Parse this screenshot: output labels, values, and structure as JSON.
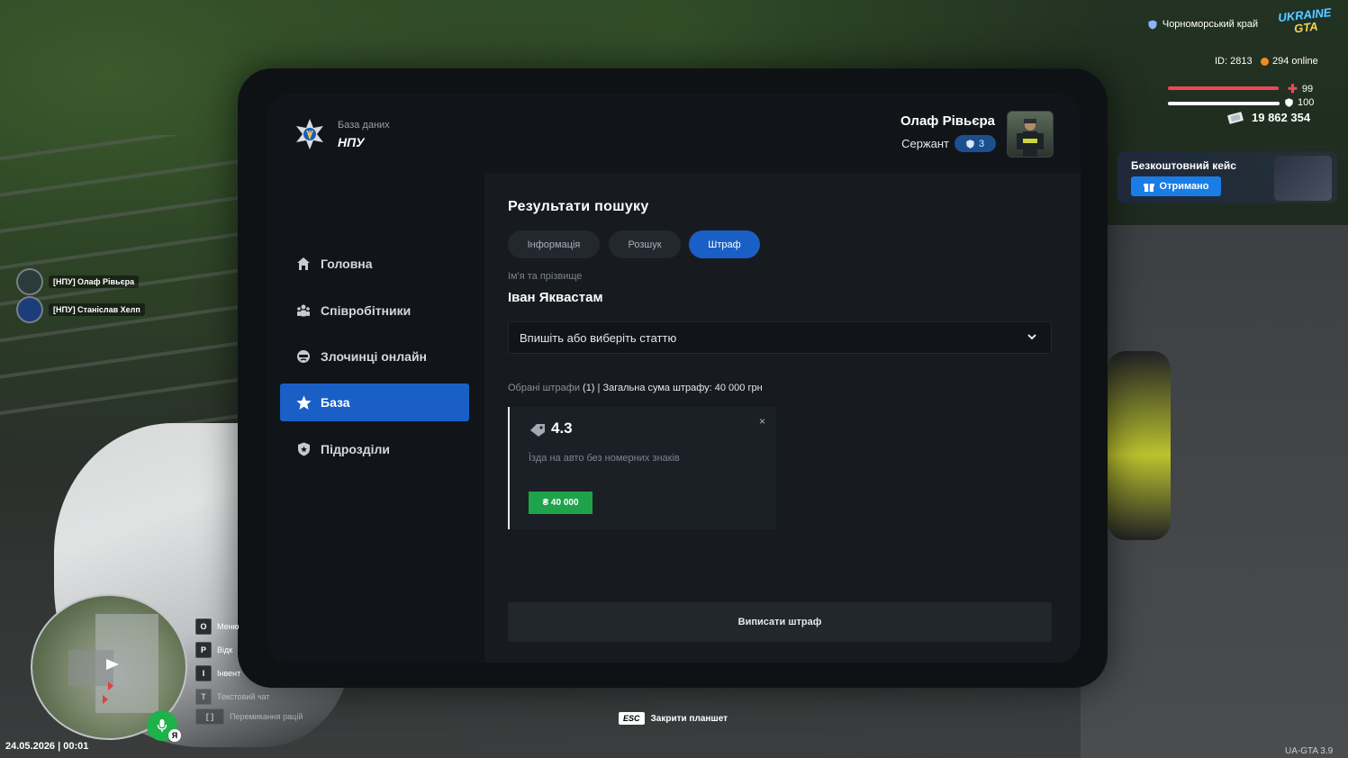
{
  "app": {
    "db_subtitle": "База даних",
    "db_title": "НПУ"
  },
  "sidebar": {
    "items": [
      {
        "label": "Головна",
        "icon": "home-icon",
        "active": false
      },
      {
        "label": "Співробітники",
        "icon": "people-icon",
        "active": false
      },
      {
        "label": "Злочинці онлайн",
        "icon": "criminal-icon",
        "active": false
      },
      {
        "label": "База",
        "icon": "star-icon",
        "active": true
      },
      {
        "label": "Підрозділи",
        "icon": "shield-icon",
        "active": false
      }
    ]
  },
  "user": {
    "name": "Олаф Рівьєра",
    "rank": "Сержант",
    "rank_level": "3"
  },
  "main": {
    "title": "Результати пошуку",
    "tabs": [
      {
        "label": "Інформація",
        "active": false
      },
      {
        "label": "Розшук",
        "active": false
      },
      {
        "label": "Штраф",
        "active": true
      }
    ],
    "name_label": "Ім'я та прізвище",
    "name_value": "Іван Яквастам",
    "article_placeholder": "Впишіть або виберіть статтю",
    "summary_prefix": "Обрані штрафи",
    "summary_value": "(1) | Загальна сума штрафу: 40 000 грн",
    "fine_card": {
      "code": "4.3",
      "description": "Їзда на авто без номерних знаків",
      "price": "₴ 40 000",
      "close": "×"
    },
    "submit_label": "Виписати штраф"
  },
  "hud": {
    "region": "Чорноморський край",
    "logo_top": "UKRAINE",
    "logo_bottom": "GTA",
    "id": "ID: 2813",
    "online": "294 online",
    "health": "99",
    "armor": "100",
    "health_fraction": 0.99,
    "armor_fraction": 1.0,
    "money": "19 862 354",
    "case_title": "Безкоштовний кейс",
    "case_button": "Отримано",
    "players": [
      "[НПУ] Олаф Рівьєра",
      "[НПУ] Станіслав Хелп"
    ],
    "keys": [
      {
        "key": "O",
        "label": "Меню"
      },
      {
        "key": "P",
        "label": "Відк"
      },
      {
        "key": "I",
        "label": "Інвент"
      },
      {
        "key": "T",
        "label": "Текстовий чат"
      },
      {
        "key": "[ ]",
        "label": "Перемикання рацій"
      }
    ],
    "mic_label": "Я",
    "datetime": "24.05.2026 | 00:01",
    "esc_key": "ESC",
    "esc_label": "Закрити планшет",
    "version": "UA-GTA 3.9"
  },
  "colors": {
    "accent": "#1a5fc6",
    "price_green": "#1ea34a",
    "health_red": "#e8495a",
    "mic_green": "#1fb14a"
  }
}
